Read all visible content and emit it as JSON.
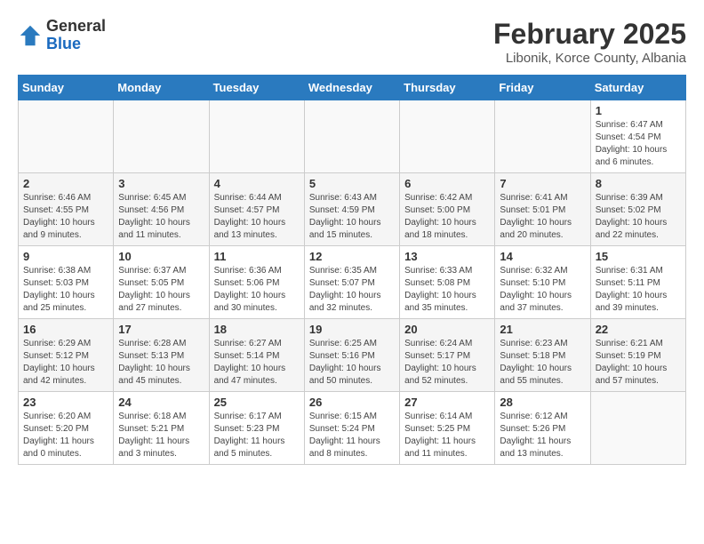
{
  "header": {
    "logo_general": "General",
    "logo_blue": "Blue",
    "title": "February 2025",
    "subtitle": "Libonik, Korce County, Albania"
  },
  "days_of_week": [
    "Sunday",
    "Monday",
    "Tuesday",
    "Wednesday",
    "Thursday",
    "Friday",
    "Saturday"
  ],
  "weeks": [
    [
      {
        "day": "",
        "info": ""
      },
      {
        "day": "",
        "info": ""
      },
      {
        "day": "",
        "info": ""
      },
      {
        "day": "",
        "info": ""
      },
      {
        "day": "",
        "info": ""
      },
      {
        "day": "",
        "info": ""
      },
      {
        "day": "1",
        "info": "Sunrise: 6:47 AM\nSunset: 4:54 PM\nDaylight: 10 hours\nand 6 minutes."
      }
    ],
    [
      {
        "day": "2",
        "info": "Sunrise: 6:46 AM\nSunset: 4:55 PM\nDaylight: 10 hours\nand 9 minutes."
      },
      {
        "day": "3",
        "info": "Sunrise: 6:45 AM\nSunset: 4:56 PM\nDaylight: 10 hours\nand 11 minutes."
      },
      {
        "day": "4",
        "info": "Sunrise: 6:44 AM\nSunset: 4:57 PM\nDaylight: 10 hours\nand 13 minutes."
      },
      {
        "day": "5",
        "info": "Sunrise: 6:43 AM\nSunset: 4:59 PM\nDaylight: 10 hours\nand 15 minutes."
      },
      {
        "day": "6",
        "info": "Sunrise: 6:42 AM\nSunset: 5:00 PM\nDaylight: 10 hours\nand 18 minutes."
      },
      {
        "day": "7",
        "info": "Sunrise: 6:41 AM\nSunset: 5:01 PM\nDaylight: 10 hours\nand 20 minutes."
      },
      {
        "day": "8",
        "info": "Sunrise: 6:39 AM\nSunset: 5:02 PM\nDaylight: 10 hours\nand 22 minutes."
      }
    ],
    [
      {
        "day": "9",
        "info": "Sunrise: 6:38 AM\nSunset: 5:03 PM\nDaylight: 10 hours\nand 25 minutes."
      },
      {
        "day": "10",
        "info": "Sunrise: 6:37 AM\nSunset: 5:05 PM\nDaylight: 10 hours\nand 27 minutes."
      },
      {
        "day": "11",
        "info": "Sunrise: 6:36 AM\nSunset: 5:06 PM\nDaylight: 10 hours\nand 30 minutes."
      },
      {
        "day": "12",
        "info": "Sunrise: 6:35 AM\nSunset: 5:07 PM\nDaylight: 10 hours\nand 32 minutes."
      },
      {
        "day": "13",
        "info": "Sunrise: 6:33 AM\nSunset: 5:08 PM\nDaylight: 10 hours\nand 35 minutes."
      },
      {
        "day": "14",
        "info": "Sunrise: 6:32 AM\nSunset: 5:10 PM\nDaylight: 10 hours\nand 37 minutes."
      },
      {
        "day": "15",
        "info": "Sunrise: 6:31 AM\nSunset: 5:11 PM\nDaylight: 10 hours\nand 39 minutes."
      }
    ],
    [
      {
        "day": "16",
        "info": "Sunrise: 6:29 AM\nSunset: 5:12 PM\nDaylight: 10 hours\nand 42 minutes."
      },
      {
        "day": "17",
        "info": "Sunrise: 6:28 AM\nSunset: 5:13 PM\nDaylight: 10 hours\nand 45 minutes."
      },
      {
        "day": "18",
        "info": "Sunrise: 6:27 AM\nSunset: 5:14 PM\nDaylight: 10 hours\nand 47 minutes."
      },
      {
        "day": "19",
        "info": "Sunrise: 6:25 AM\nSunset: 5:16 PM\nDaylight: 10 hours\nand 50 minutes."
      },
      {
        "day": "20",
        "info": "Sunrise: 6:24 AM\nSunset: 5:17 PM\nDaylight: 10 hours\nand 52 minutes."
      },
      {
        "day": "21",
        "info": "Sunrise: 6:23 AM\nSunset: 5:18 PM\nDaylight: 10 hours\nand 55 minutes."
      },
      {
        "day": "22",
        "info": "Sunrise: 6:21 AM\nSunset: 5:19 PM\nDaylight: 10 hours\nand 57 minutes."
      }
    ],
    [
      {
        "day": "23",
        "info": "Sunrise: 6:20 AM\nSunset: 5:20 PM\nDaylight: 11 hours\nand 0 minutes."
      },
      {
        "day": "24",
        "info": "Sunrise: 6:18 AM\nSunset: 5:21 PM\nDaylight: 11 hours\nand 3 minutes."
      },
      {
        "day": "25",
        "info": "Sunrise: 6:17 AM\nSunset: 5:23 PM\nDaylight: 11 hours\nand 5 minutes."
      },
      {
        "day": "26",
        "info": "Sunrise: 6:15 AM\nSunset: 5:24 PM\nDaylight: 11 hours\nand 8 minutes."
      },
      {
        "day": "27",
        "info": "Sunrise: 6:14 AM\nSunset: 5:25 PM\nDaylight: 11 hours\nand 11 minutes."
      },
      {
        "day": "28",
        "info": "Sunrise: 6:12 AM\nSunset: 5:26 PM\nDaylight: 11 hours\nand 13 minutes."
      },
      {
        "day": "",
        "info": ""
      }
    ]
  ]
}
